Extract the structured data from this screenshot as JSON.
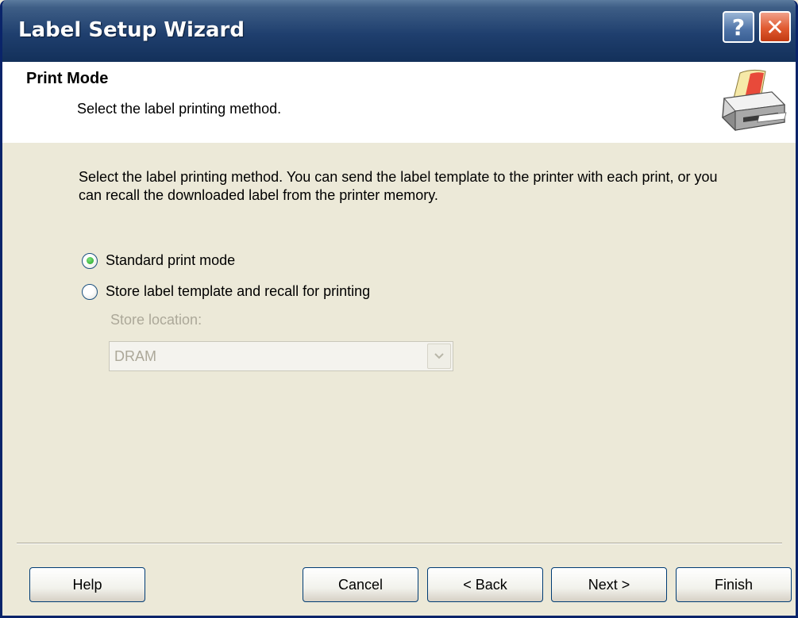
{
  "window": {
    "title": "Label Setup Wizard",
    "help_label": "?",
    "close_label": "✕"
  },
  "header": {
    "title": "Print Mode",
    "subtitle": "Select the label printing method."
  },
  "content": {
    "description": "Select the label printing method. You can send the label template to the printer with each print, or you can recall the downloaded label from the printer memory.",
    "options": [
      {
        "label": "Standard print mode",
        "selected": true
      },
      {
        "label": "Store label template and recall for printing",
        "selected": false
      }
    ],
    "store_location_label": "Store location:",
    "store_location_value": "DRAM"
  },
  "buttons": {
    "help": "Help",
    "cancel": "Cancel",
    "back": "< Back",
    "next": "Next >",
    "finish": "Finish"
  },
  "icons": {
    "header_icon": "printer-icon",
    "dropdown_icon": "chevron-down-icon"
  },
  "colors": {
    "titlebar": "#1f3f6e",
    "dialog_bg": "#ece9d8",
    "radio_selected": "#21a121",
    "disabled_text": "#aca899"
  }
}
